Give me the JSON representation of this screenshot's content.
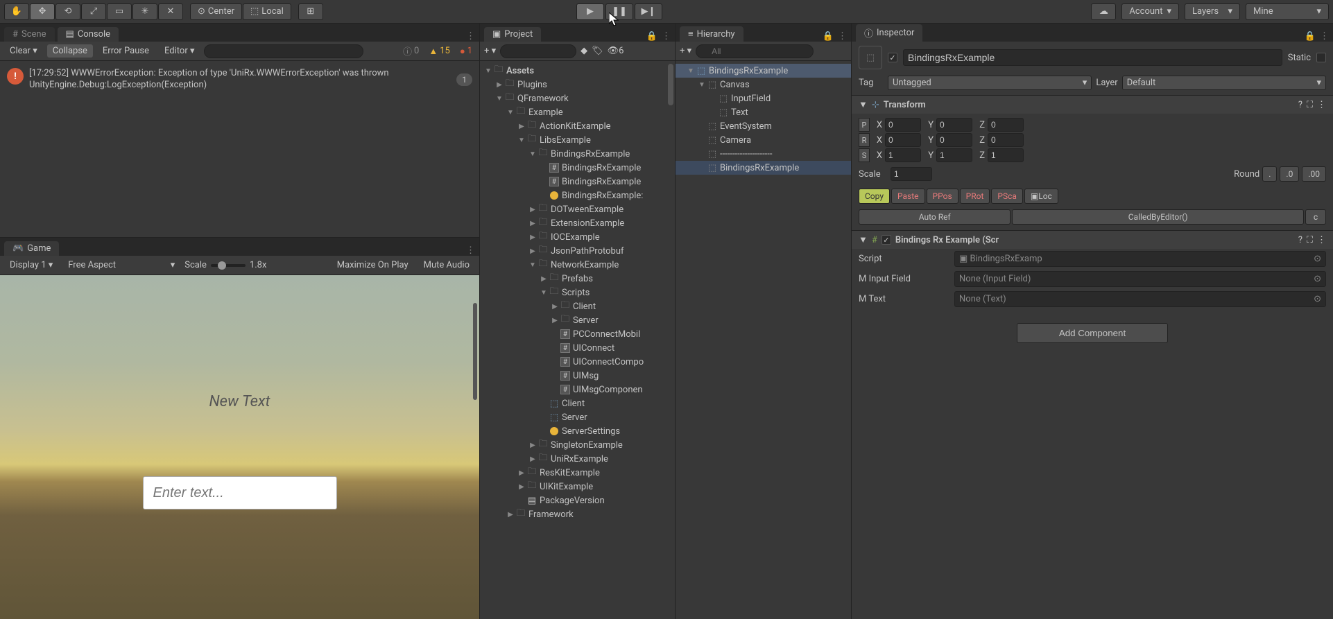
{
  "toolbar": {
    "center": "Center",
    "local": "Local",
    "account": "Account",
    "layers": "Layers",
    "layout": "Mine"
  },
  "tabs": {
    "scene": "Scene",
    "console": "Console",
    "game": "Game",
    "project": "Project",
    "hierarchy": "Hierarchy",
    "inspector": "Inspector"
  },
  "console": {
    "clear": "Clear",
    "collapse": "Collapse",
    "errorPause": "Error Pause",
    "editor": "Editor",
    "info_count": "0",
    "warn_count": "15",
    "err_count": "1",
    "log_time": "[17:29:52]",
    "log_line1": "WWWErrorException: Exception of type 'UniRx.WWWErrorException' was thrown",
    "log_line2": "UnityEngine.Debug:LogException(Exception)",
    "log_badge": "1"
  },
  "game": {
    "display": "Display 1",
    "aspect": "Free Aspect",
    "scale_label": "Scale",
    "scale_value": "1.8x",
    "maximize": "Maximize On Play",
    "mute": "Mute Audio",
    "newText": "New Text",
    "enterText": "Enter text..."
  },
  "project": {
    "hidden_count": "6",
    "tree": [
      {
        "d": 0,
        "a": "▼",
        "i": "folder",
        "t": "Assets",
        "bold": true
      },
      {
        "d": 1,
        "a": "▶",
        "i": "folder",
        "t": "Plugins"
      },
      {
        "d": 1,
        "a": "▼",
        "i": "folder",
        "t": "QFramework"
      },
      {
        "d": 2,
        "a": "▼",
        "i": "folder",
        "t": "Example"
      },
      {
        "d": 3,
        "a": "▶",
        "i": "folder",
        "t": "ActionKitExample"
      },
      {
        "d": 3,
        "a": "▼",
        "i": "folder",
        "t": "LibsExample"
      },
      {
        "d": 4,
        "a": "▼",
        "i": "folder",
        "t": "BindingsRxExample"
      },
      {
        "d": 5,
        "a": "",
        "i": "script",
        "t": "BindingsRxExample"
      },
      {
        "d": 5,
        "a": "",
        "i": "script",
        "t": "BindingsRxExample"
      },
      {
        "d": 5,
        "a": "",
        "i": "yellow",
        "t": "BindingsRxExample:"
      },
      {
        "d": 4,
        "a": "▶",
        "i": "folder",
        "t": "DOTweenExample"
      },
      {
        "d": 4,
        "a": "▶",
        "i": "folder",
        "t": "ExtensionExample"
      },
      {
        "d": 4,
        "a": "▶",
        "i": "folder",
        "t": "IOCExample"
      },
      {
        "d": 4,
        "a": "▶",
        "i": "folder",
        "t": "JsonPathProtobuf"
      },
      {
        "d": 4,
        "a": "▼",
        "i": "folder",
        "t": "NetworkExample"
      },
      {
        "d": 5,
        "a": "▶",
        "i": "folder",
        "t": "Prefabs"
      },
      {
        "d": 5,
        "a": "▼",
        "i": "folder",
        "t": "Scripts"
      },
      {
        "d": 6,
        "a": "▶",
        "i": "folder",
        "t": "Client"
      },
      {
        "d": 6,
        "a": "▶",
        "i": "folder",
        "t": "Server"
      },
      {
        "d": 6,
        "a": "",
        "i": "script",
        "t": "PCConnectMobil"
      },
      {
        "d": 6,
        "a": "",
        "i": "script",
        "t": "UIConnect"
      },
      {
        "d": 6,
        "a": "",
        "i": "script",
        "t": "UIConnectCompo"
      },
      {
        "d": 6,
        "a": "",
        "i": "script",
        "t": "UIMsg"
      },
      {
        "d": 6,
        "a": "",
        "i": "script",
        "t": "UIMsgComponen"
      },
      {
        "d": 5,
        "a": "",
        "i": "prefab",
        "t": "Client"
      },
      {
        "d": 5,
        "a": "",
        "i": "prefab",
        "t": "Server"
      },
      {
        "d": 5,
        "a": "",
        "i": "yellow",
        "t": "ServerSettings"
      },
      {
        "d": 4,
        "a": "▶",
        "i": "folder",
        "t": "SingletonExample"
      },
      {
        "d": 4,
        "a": "▶",
        "i": "folder",
        "t": "UniRxExample"
      },
      {
        "d": 3,
        "a": "▶",
        "i": "folder",
        "t": "ResKitExample"
      },
      {
        "d": 3,
        "a": "▶",
        "i": "folder",
        "t": "UIKitExample"
      },
      {
        "d": 3,
        "a": "",
        "i": "file",
        "t": "PackageVersion"
      },
      {
        "d": 2,
        "a": "▶",
        "i": "folder",
        "t": "Framework"
      }
    ]
  },
  "hierarchy": {
    "search_placeholder": "All",
    "tree": [
      {
        "d": 0,
        "a": "▼",
        "i": "prefab",
        "t": "BindingsRxExample",
        "sel": true
      },
      {
        "d": 1,
        "a": "▼",
        "i": "obj",
        "t": "Canvas"
      },
      {
        "d": 2,
        "a": "",
        "i": "obj",
        "t": "InputField"
      },
      {
        "d": 2,
        "a": "",
        "i": "obj",
        "t": "Text"
      },
      {
        "d": 1,
        "a": "",
        "i": "obj",
        "t": "EventSystem"
      },
      {
        "d": 1,
        "a": "",
        "i": "obj",
        "t": "Camera"
      },
      {
        "d": 1,
        "a": "",
        "i": "obj",
        "t": "---------------------"
      },
      {
        "d": 1,
        "a": "",
        "i": "obj",
        "t": "BindingsRxExample",
        "hl": true
      }
    ]
  },
  "inspector": {
    "name": "BindingsRxExample",
    "static_label": "Static",
    "tag_label": "Tag",
    "tag_value": "Untagged",
    "layer_label": "Layer",
    "layer_value": "Default",
    "transform": {
      "title": "Transform",
      "p_label": "P",
      "r_label": "R",
      "s_label": "S",
      "x": "X",
      "y": "Y",
      "z": "Z",
      "px": "0",
      "py": "0",
      "pz": "0",
      "rx": "0",
      "ry": "0",
      "rz": "0",
      "sx": "1",
      "sy": "1",
      "sz": "1",
      "scale_label": "Scale",
      "scale_value": "1",
      "round_label": "Round",
      "round_dot": ".",
      "round_0": ".0",
      "round_00": ".00",
      "copy": "Copy",
      "paste": "Paste",
      "ppos": "PPos",
      "prot": "PRot",
      "psca": "PSca",
      "loc": "Loc",
      "autoref": "Auto Ref",
      "calledby": "CalledByEditor()",
      "c": "c"
    },
    "bindings": {
      "title": "Bindings Rx Example (Scr",
      "script_label": "Script",
      "script_value": "BindingsRxExamp",
      "input_label": "M Input Field",
      "input_value": "None (Input Field)",
      "text_label": "M Text",
      "text_value": "None (Text)"
    },
    "add_component": "Add Component"
  }
}
